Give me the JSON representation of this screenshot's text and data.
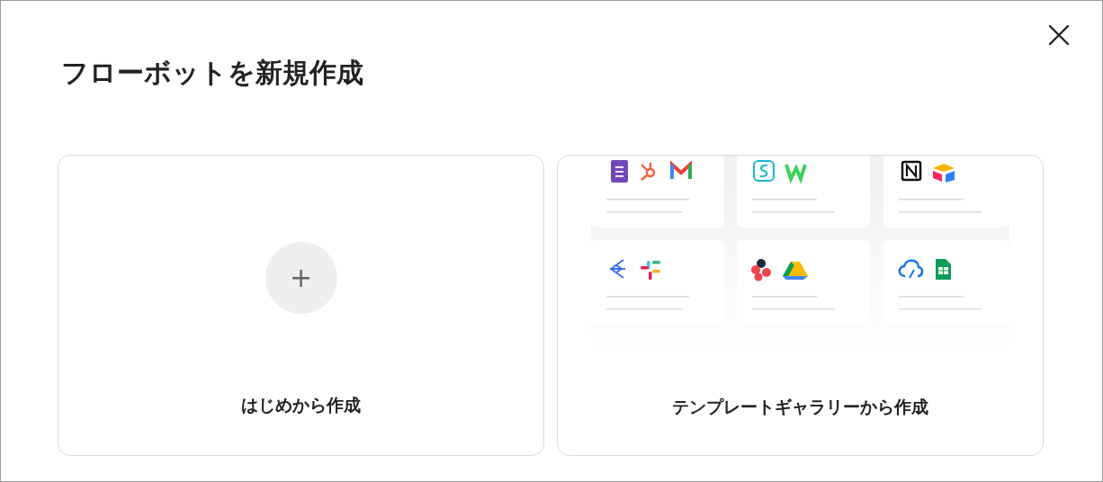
{
  "dialog": {
    "title": "フローボットを新規作成"
  },
  "options": [
    {
      "kind": "blank",
      "label": "はじめから作成",
      "symbol": "+"
    },
    {
      "kind": "gallery",
      "label": "テンプレートギャラリーから作成"
    }
  ]
}
